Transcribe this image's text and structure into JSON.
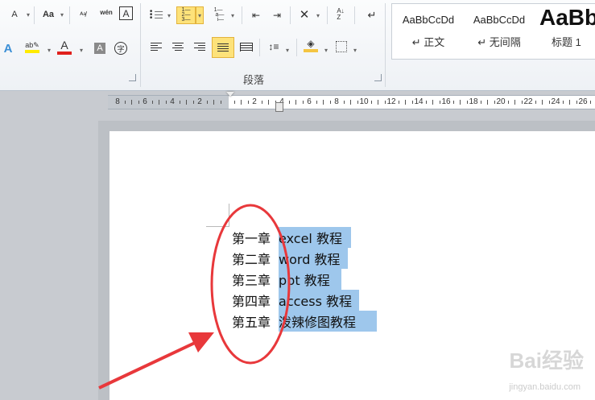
{
  "ribbon": {
    "font_row1": [
      "A",
      "Aa",
      "A",
      "wén",
      "A"
    ],
    "para_group_label": "段落",
    "styles": [
      {
        "sample": "AaBbCcDd",
        "name": "↵ 正文"
      },
      {
        "sample": "AaBbCcDd",
        "name": "↵ 无间隔"
      },
      {
        "sample": "AaBb",
        "name": "标题 1"
      }
    ]
  },
  "ruler": {
    "labels": [
      "8",
      "6",
      "4",
      "2",
      "",
      "2",
      "4",
      "6",
      "8",
      "10",
      "12",
      "14",
      "16",
      "18",
      "20",
      "22",
      "24",
      "26"
    ]
  },
  "document": {
    "lines": [
      {
        "chapter": "第一章",
        "text": "excel 教程"
      },
      {
        "chapter": "第二章",
        "text": "word 教程"
      },
      {
        "chapter": "第三章",
        "text": "ppt 教程"
      },
      {
        "chapter": "第四章",
        "text": "access 教程"
      },
      {
        "chapter": "第五章",
        "text": "泼辣修图教程"
      }
    ]
  },
  "annotation_color": "#e8383b",
  "highlight_color": "#9ec7ec",
  "watermark": {
    "main": "Bai经验",
    "sub": "jingyan.baidu.com"
  }
}
